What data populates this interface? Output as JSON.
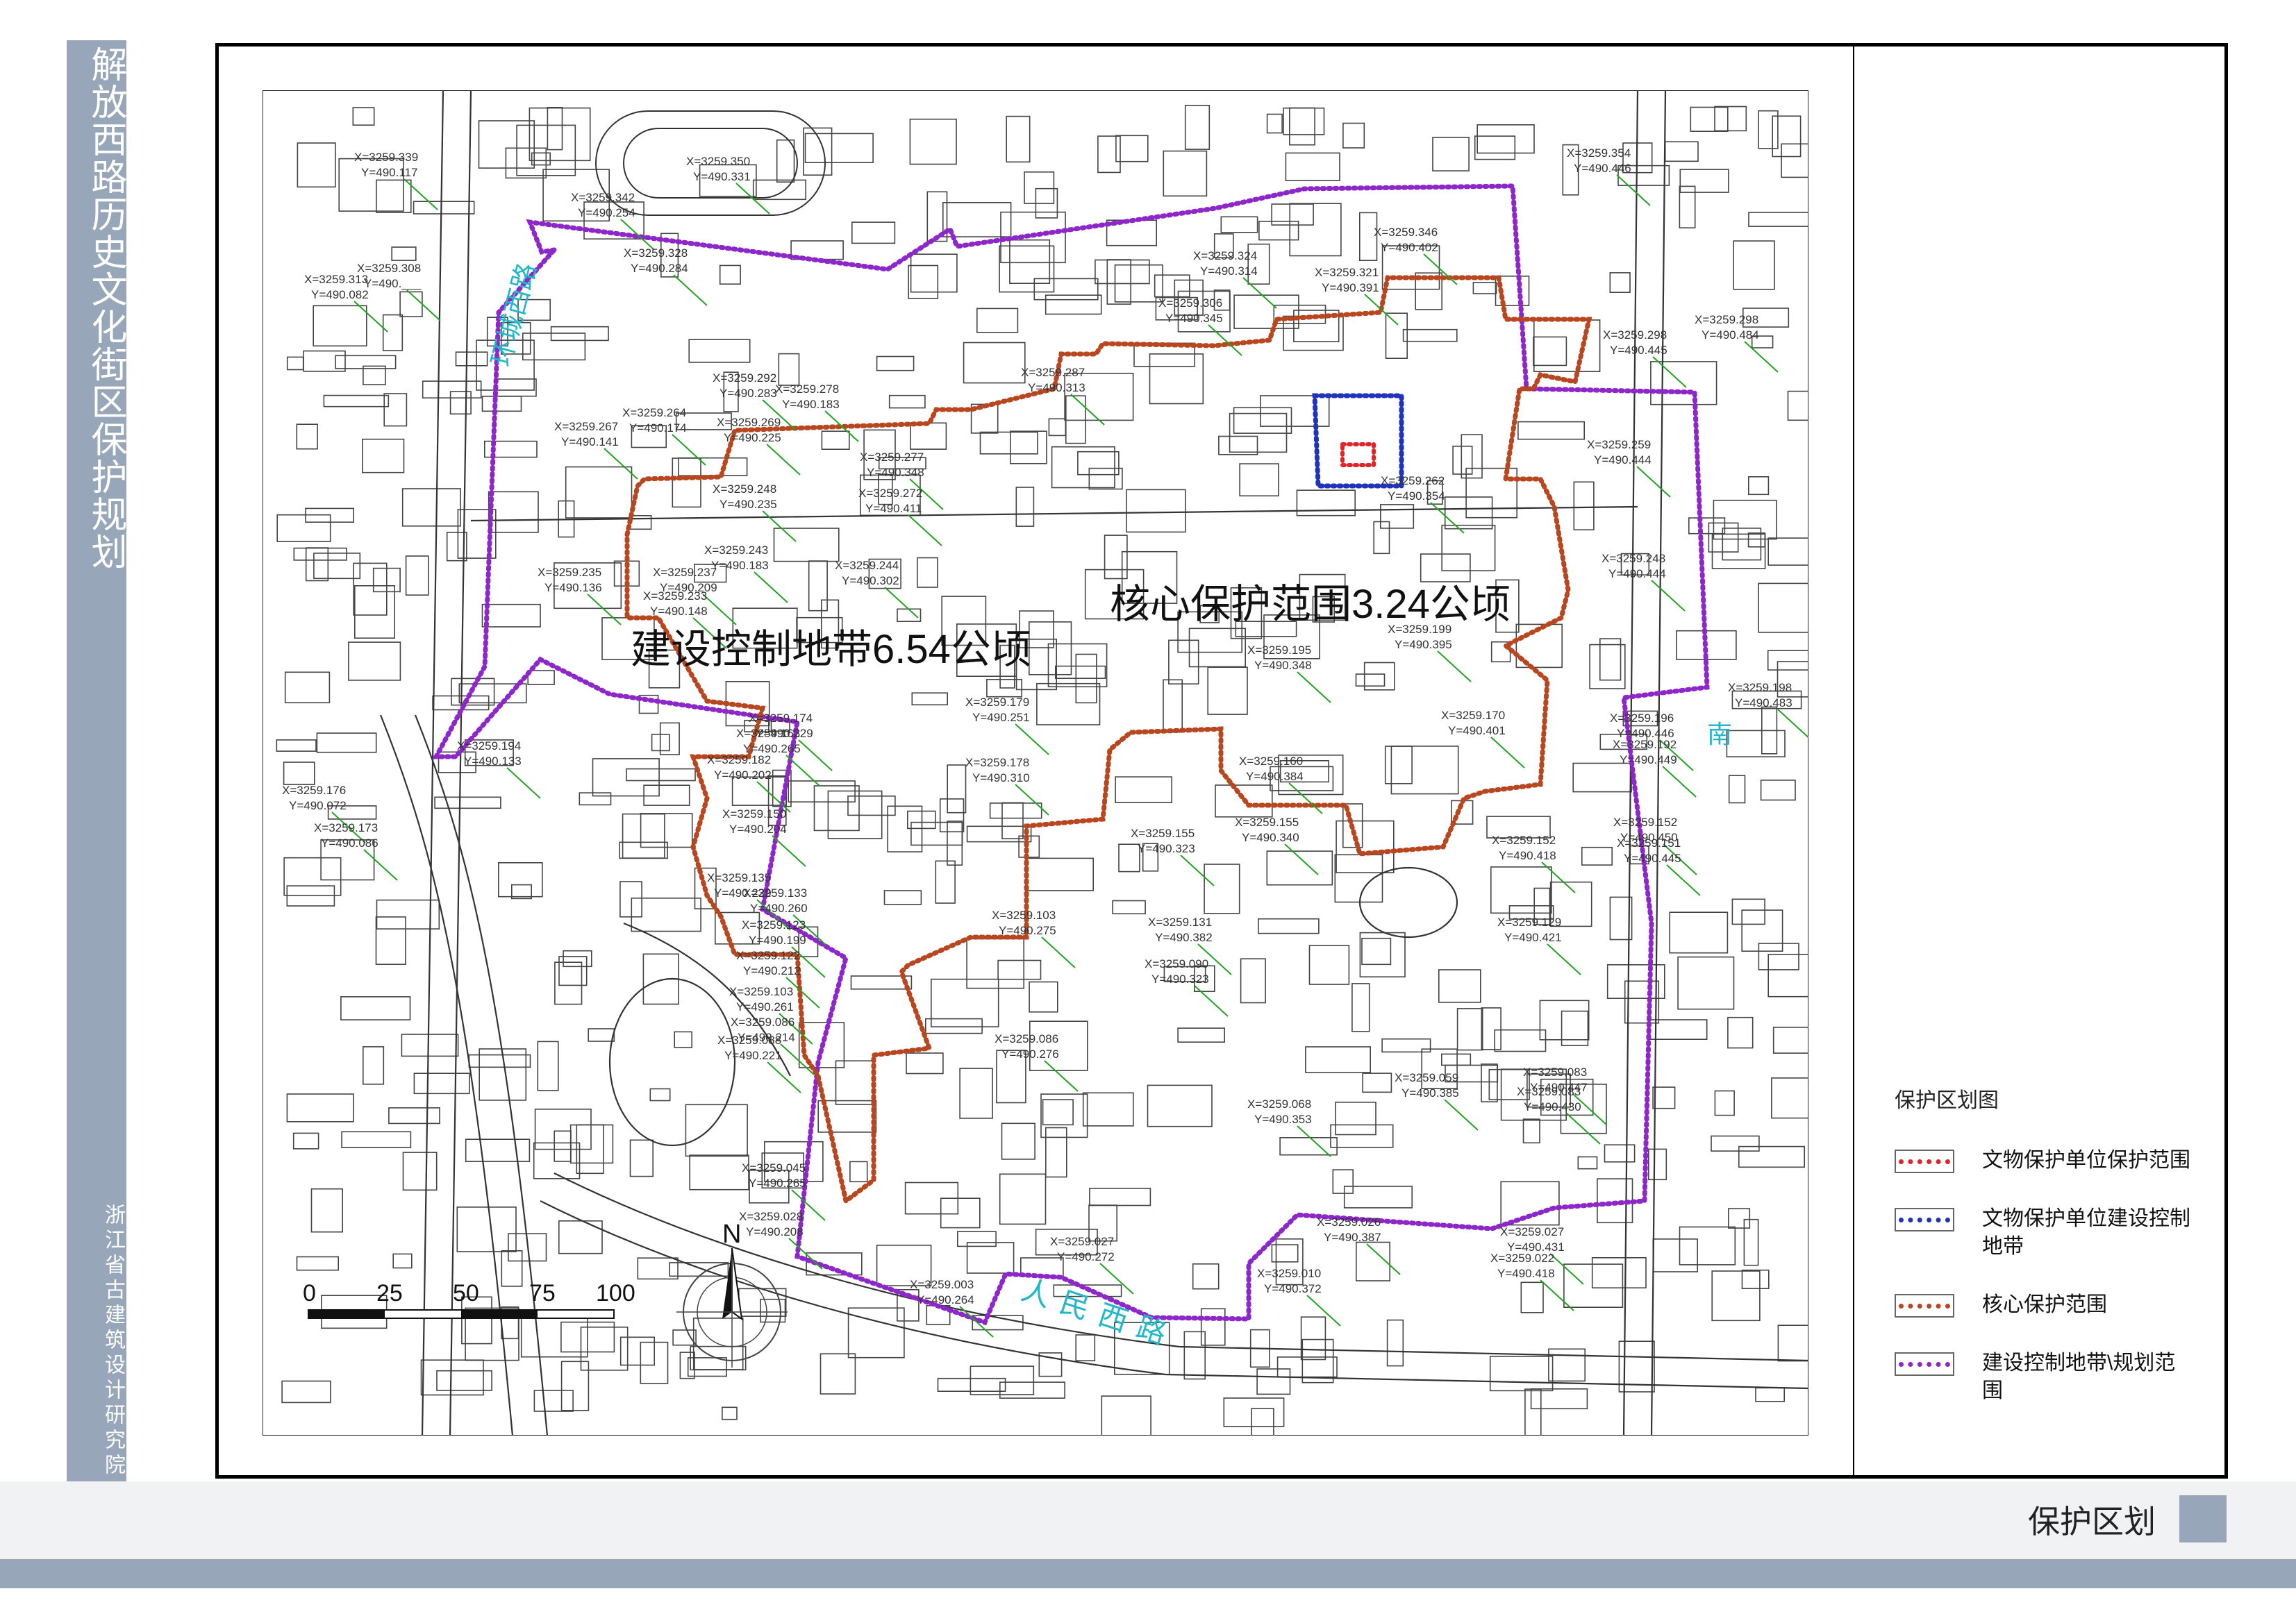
{
  "sidebar": {
    "title": "解放西路历史文化街区保护规划",
    "organization": "浙江省古建筑设计研究院"
  },
  "map": {
    "labels": {
      "core_area": "核心保护范围3.24公顷",
      "control_area": "建设控制地带6.54公顷"
    },
    "street_names": {
      "huancheng_west": "环城西路",
      "renmin_west": "人民西路",
      "south": "南"
    },
    "coordinates": [
      {
        "x": "X=3259.339",
        "y": "Y=490.117"
      },
      {
        "x": "X=3259.342",
        "y": "Y=490.254"
      },
      {
        "x": "X=3259.350",
        "y": "Y=490.331"
      },
      {
        "x": "X=3259.354",
        "y": "Y=490.446"
      },
      {
        "x": "X=3259.313",
        "y": "Y=490.082"
      },
      {
        "x": "X=3259.308",
        "y": "Y=490.___"
      },
      {
        "x": "X=3259.346",
        "y": "Y=490.402"
      },
      {
        "x": "X=3259.328",
        "y": "Y=490.284"
      },
      {
        "x": "X=3259.324",
        "y": "Y=490.314"
      },
      {
        "x": "X=3259.321",
        "y": "Y=490.391"
      },
      {
        "x": "X=3259.306",
        "y": "Y=490.345"
      },
      {
        "x": "X=3259.298",
        "y": "Y=490.445"
      },
      {
        "x": "X=3259.298",
        "y": "Y=490.484"
      },
      {
        "x": "X=3259.278",
        "y": "Y=490.183"
      },
      {
        "x": "X=3259.292",
        "y": "Y=490.283"
      },
      {
        "x": "X=3259.287",
        "y": "Y=490.313"
      },
      {
        "x": "X=3259.267",
        "y": "Y=490.141"
      },
      {
        "x": "X=3259.264",
        "y": "Y=490.174"
      },
      {
        "x": "X=3259.269",
        "y": "Y=490.225"
      },
      {
        "x": "X=3259.248",
        "y": "Y=490.235"
      },
      {
        "x": "X=3259.277",
        "y": "Y=490.348"
      },
      {
        "x": "X=3259.272",
        "y": "Y=490.411"
      },
      {
        "x": "X=3259.259",
        "y": "Y=490.444"
      },
      {
        "x": "X=3259.262",
        "y": "Y=490.354"
      },
      {
        "x": "X=3259.243",
        "y": "Y=490.183"
      },
      {
        "x": "X=3259.235",
        "y": "Y=490.136"
      },
      {
        "x": "X=3259.237",
        "y": "Y=490.209"
      },
      {
        "x": "X=3259.233",
        "y": "Y=490.148"
      },
      {
        "x": "X=3259.244",
        "y": "Y=490.302"
      },
      {
        "x": "X=3259.248",
        "y": "Y=490.444"
      },
      {
        "x": "X=3259.199",
        "y": "Y=490.395"
      },
      {
        "x": "X=3259.195",
        "y": "Y=490.348"
      },
      {
        "x": "X=3259.179",
        "y": "Y=490.251"
      },
      {
        "x": "X=3259.174",
        "y": "Y=490.229"
      },
      {
        "x": "X=3259.163",
        "y": "Y=490.265"
      },
      {
        "x": "X=3259.194",
        "y": "Y=490.133"
      },
      {
        "x": "X=3259.182",
        "y": "Y=490.202"
      },
      {
        "x": "X=3259.176",
        "y": "Y=490.072"
      },
      {
        "x": "X=3259.173",
        "y": "Y=490.086"
      },
      {
        "x": "X=3259.170",
        "y": "Y=490.401"
      },
      {
        "x": "X=3259.196",
        "y": "Y=490.446"
      },
      {
        "x": "X=3259.192",
        "y": "Y=490.449"
      },
      {
        "x": "X=3259.198",
        "y": "Y=490.483"
      },
      {
        "x": "X=3259.178",
        "y": "Y=490.310"
      },
      {
        "x": "X=3259.160",
        "y": "Y=490.384"
      },
      {
        "x": "X=3259.150",
        "y": "Y=490.204"
      },
      {
        "x": "X=3259.155",
        "y": "Y=490.340"
      },
      {
        "x": "X=3259.155",
        "y": "Y=490.323"
      },
      {
        "x": "X=3259.152",
        "y": "Y=490.418"
      },
      {
        "x": "X=3259.152",
        "y": "Y=490.450"
      },
      {
        "x": "X=3259.151",
        "y": "Y=490.445"
      },
      {
        "x": "X=3259.135",
        "y": "Y=490.229"
      },
      {
        "x": "X=3259.133",
        "y": "Y=490.260"
      },
      {
        "x": "X=3259.123",
        "y": "Y=490.199"
      },
      {
        "x": "X=3259.122",
        "y": "Y=490.212"
      },
      {
        "x": "X=3259.103",
        "y": "Y=490.275"
      },
      {
        "x": "X=3259.131",
        "y": "Y=490.382"
      },
      {
        "x": "X=3259.129",
        "y": "Y=490.421"
      },
      {
        "x": "X=3259.090",
        "y": "Y=490.323"
      },
      {
        "x": "X=3259.103",
        "y": "Y=490.261"
      },
      {
        "x": "X=3259.086",
        "y": "Y=490.214"
      },
      {
        "x": "X=3259.088",
        "y": "Y=490.221"
      },
      {
        "x": "X=3259.086",
        "y": "Y=490.276"
      },
      {
        "x": "X=3259.068",
        "y": "Y=490.353"
      },
      {
        "x": "X=3259.059",
        "y": "Y=490.385"
      },
      {
        "x": "X=3259.083",
        "y": "Y=490.447"
      },
      {
        "x": "X=3259.083",
        "y": "Y=490.430"
      },
      {
        "x": "X=3259.045",
        "y": "Y=490.265"
      },
      {
        "x": "X=3259.028",
        "y": "Y=490.208"
      },
      {
        "x": "X=3259.026",
        "y": "Y=490.387"
      },
      {
        "x": "X=3259.027",
        "y": "Y=490.431"
      },
      {
        "x": "X=3259.022",
        "y": "Y=490.418"
      },
      {
        "x": "X=3259.027",
        "y": "Y=490.272"
      },
      {
        "x": "X=3259.003",
        "y": "Y=490.264"
      },
      {
        "x": "X=3259.010",
        "y": "Y=490.372"
      }
    ],
    "scale": {
      "ticks": [
        "0",
        "25",
        "50",
        "75",
        "100"
      ]
    },
    "north": "N"
  },
  "legend": {
    "title": "保护区划图",
    "items": [
      {
        "label": "文物保护单位保护范围",
        "color": "#e0242a"
      },
      {
        "label": "文物保护单位建设控制地带",
        "color": "#1f34b8"
      },
      {
        "label": "核心保护范围",
        "color": "#b8461e"
      },
      {
        "label": "建设控制地带\\规划范围",
        "color": "#8e27c9"
      }
    ]
  },
  "footer": {
    "title": "保护区划"
  },
  "colors": {
    "accent": "#97a6b8",
    "core_boundary": "#b8461e",
    "control_boundary": "#8e27c9",
    "relic_boundary": "#e0242a",
    "relic_control_boundary": "#1f34b8",
    "leader_line": "#22a322",
    "street_label": "#22b7c9"
  }
}
